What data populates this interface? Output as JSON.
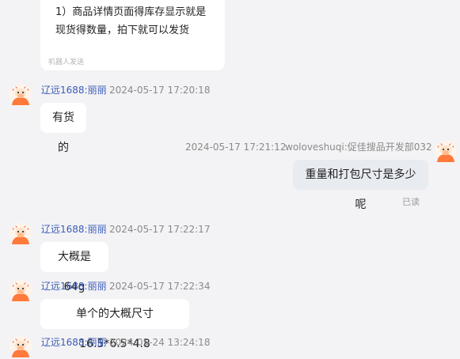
{
  "robot_message": {
    "line1": "1）商品详情页面得库存显示就是",
    "line2": "现货得数量，拍下就可以发货",
    "robot_label": "机器人发送"
  },
  "messages": [
    {
      "sender": "辽远1688:丽丽",
      "time": "2024-05-17 17:20:18",
      "text": "有货的"
    },
    {
      "sender": "woloveshuqi:促佳搜品开发部032",
      "time": "2024-05-17 17:21:12",
      "text": "重量和打包尺寸是多少呢",
      "status": "已读"
    },
    {
      "sender": "辽远1688:丽丽",
      "time": "2024-05-17 17:22:17",
      "text": "大概是 64g"
    },
    {
      "sender": "辽远1688:丽丽",
      "time": "2024-05-17 17:22:34",
      "text": "单个的大概尺寸16.5*6.5*4.8"
    },
    {
      "sender": "辽远1688:丽丽",
      "time": "2024-05-24 13:24:18",
      "text": ""
    }
  ],
  "colors": {
    "background": "#f3f3f5",
    "bubble_incoming": "#ffffff",
    "bubble_outgoing": "#e8ebf0",
    "sender_name": "#3b5cb8",
    "avatar_orange": "#ff8a3d"
  }
}
